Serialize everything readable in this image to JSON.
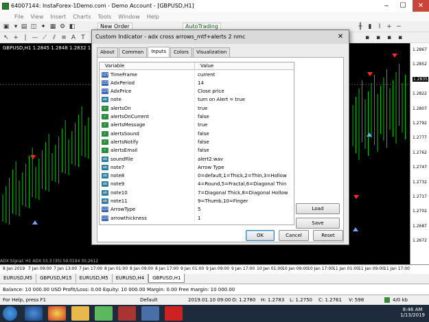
{
  "window": {
    "title": "64007144: InstaForex-1Demo.com - Demo Account - [GBPUSD,H1]",
    "minimize": "‒",
    "maximize": "☐",
    "close": "✕"
  },
  "menu": [
    "File",
    "View",
    "Insert",
    "Charts",
    "Tools",
    "Window",
    "Help"
  ],
  "toolbar": {
    "new_order": "New Order",
    "auto_trading": "AutoTrading"
  },
  "chart": {
    "info": "GBPUSD,H1  1.2845 1.2848 1.2832 1.2835",
    "indicator_line": "ADX Signal: H1 ADX 53.3 (35) 59.0194 30.2612",
    "current_price": "1.2835",
    "price_labels": [
      "1.2867",
      "1.2852",
      "1.2835",
      "1.2822",
      "1.2807",
      "1.2792",
      "1.2777",
      "1.2762",
      "1.2747",
      "1.2732",
      "1.2717",
      "1.2702",
      "1.2687",
      "1.2672"
    ],
    "time_labels": [
      "8 Jan 2019",
      "7 Jan 09:00",
      "7 Jan 13:00",
      "7 Jan 17:00",
      "8 Jan 01:00",
      "8 Jan 09:00",
      "8 Jan 17:00",
      "9 Jan 01:00",
      "9 Jan 09:00",
      "9 Jan 17:00",
      "10 Jan 01:00",
      "10 Jan 09:00",
      "10 Jan 17:00",
      "11 Jan 01:00",
      "11 Jan 09:00",
      "11 Jan 17:00"
    ],
    "colors": {
      "background": "#000000",
      "bull": "#00c800",
      "arrow_up": "#6fa8ff",
      "arrow_down": "#ff2a2a"
    }
  },
  "chart_tabs": [
    "EURUSD,M5",
    "GBPUSD,M15",
    "EURUSD,M5",
    "EURUSD,H4",
    "GBPUSD,H1"
  ],
  "active_chart_tab": "GBPUSD,H1",
  "account": "Balance: 10 000.00 USD  Profit/Loss: 0.00  Equity: 10 000.00  Margin: 0.00  Free margin: 10 000.00",
  "status": {
    "help": "For Help, press F1",
    "profile": "Default",
    "datetime": "2019.01.10 09:00",
    "open": "O: 1.2780",
    "high": "H: 1.2783",
    "low": "L: 1.2750",
    "close": "C: 1.2761",
    "volume": "V: 598",
    "traffic": "4/0 kb"
  },
  "taskbar": {
    "time": "8:46 AM",
    "date": "1/13/2019"
  },
  "dialog": {
    "title": "Custom Indicator - adx cross arrows_mtf+alerts 2 nmc",
    "close": "✕",
    "tabs": [
      "About",
      "Common",
      "Inputs",
      "Colors",
      "Visualization"
    ],
    "active_tab": "Inputs",
    "columns": {
      "variable": "Variable",
      "value": "Value"
    },
    "rows": [
      {
        "type": "int",
        "name": "TimeFrame",
        "value": "current"
      },
      {
        "type": "int",
        "name": "AdxPeriod",
        "value": "14"
      },
      {
        "type": "int",
        "name": "AdxPrice",
        "value": "Close price"
      },
      {
        "type": "str",
        "name": "note",
        "value": "turn on Alert = true"
      },
      {
        "type": "bool",
        "name": "alertsOn",
        "value": "true"
      },
      {
        "type": "bool",
        "name": "alertsOnCurrent",
        "value": "false"
      },
      {
        "type": "bool",
        "name": "alertsMessage",
        "value": "true"
      },
      {
        "type": "bool",
        "name": "alertsSound",
        "value": "false"
      },
      {
        "type": "bool",
        "name": "alertsNotify",
        "value": "false"
      },
      {
        "type": "bool",
        "name": "alertsEmail",
        "value": "false"
      },
      {
        "type": "str",
        "name": "soundFile",
        "value": "alert2.wav"
      },
      {
        "type": "str",
        "name": "note7",
        "value": "Arrow Type"
      },
      {
        "type": "str",
        "name": "note8",
        "value": "0=default,1=Thick,2=Thin,3=Hollow"
      },
      {
        "type": "str",
        "name": "note9",
        "value": "4=Round,5=Fractal,6=Diagonal Thin"
      },
      {
        "type": "str",
        "name": "note10",
        "value": "7=Diagonal Thick,8=Diagonal Hollow"
      },
      {
        "type": "str",
        "name": "note11",
        "value": "9=Thumb,10=Finger"
      },
      {
        "type": "int",
        "name": "ArrowType",
        "value": "5"
      },
      {
        "type": "int",
        "name": "arrowthickness",
        "value": "1"
      }
    ],
    "type_icons": {
      "int": "123",
      "str": "ab",
      "bool": "✓"
    },
    "buttons": {
      "load": "Load",
      "save": "Save",
      "ok": "OK",
      "cancel": "Cancel",
      "reset": "Reset"
    }
  }
}
